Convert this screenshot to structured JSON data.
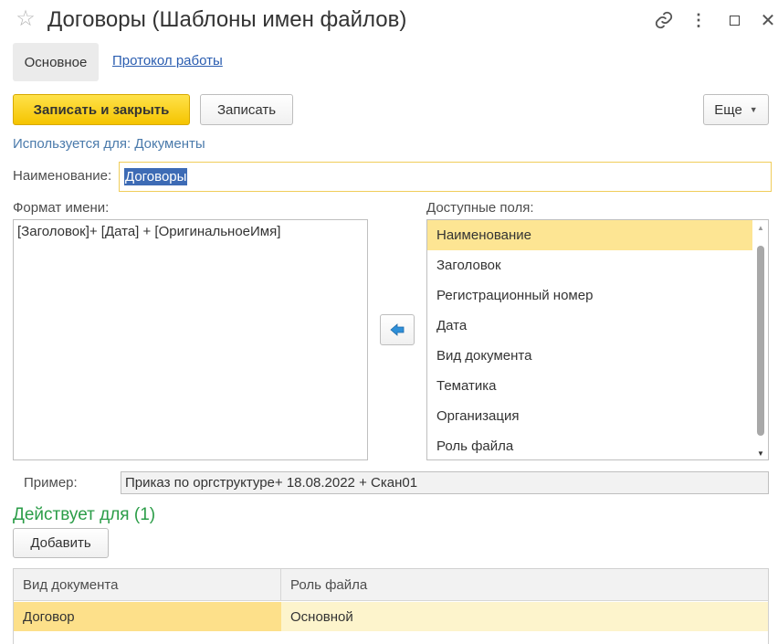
{
  "window": {
    "title": "Договоры (Шаблоны имен файлов)"
  },
  "tabs": {
    "main": "Основное",
    "log": "Протокол работы"
  },
  "toolbar": {
    "save_close": "Записать и закрыть",
    "save": "Записать",
    "more": "Еще"
  },
  "used_for": "Используется для: Документы",
  "name": {
    "label": "Наименование:",
    "value": "Договоры"
  },
  "format": {
    "label": "Формат имени:",
    "value": "[Заголовок]+ [Дата] + [ОригинальноеИмя]"
  },
  "fields": {
    "label": "Доступные поля:",
    "items": [
      "Наименование",
      "Заголовок",
      "Регистрационный номер",
      "Дата",
      "Вид документа",
      "Тематика",
      "Организация",
      "Роль файла"
    ],
    "selected_index": 0
  },
  "example": {
    "label": "Пример:",
    "value": "Приказ по оргструктуре+ 18.08.2022 + Скан01"
  },
  "applies": {
    "title": "Действует для (1)",
    "add_button": "Добавить",
    "columns": [
      "Вид документа",
      "Роль файла"
    ],
    "rows": [
      [
        "Договор",
        "Основной"
      ]
    ]
  },
  "icons": {
    "favorite": "star-outline-icon",
    "link": "link-icon",
    "menu": "more-vertical-icon",
    "maximize": "maximize-icon",
    "close": "close-icon",
    "add_field": "arrow-left-icon",
    "dropdown": "caret-down-icon"
  },
  "colors": {
    "primary_button": "#f5c400",
    "selection": "#fde593",
    "accent_green": "#2b9d48",
    "link_blue": "#2a5db0"
  }
}
